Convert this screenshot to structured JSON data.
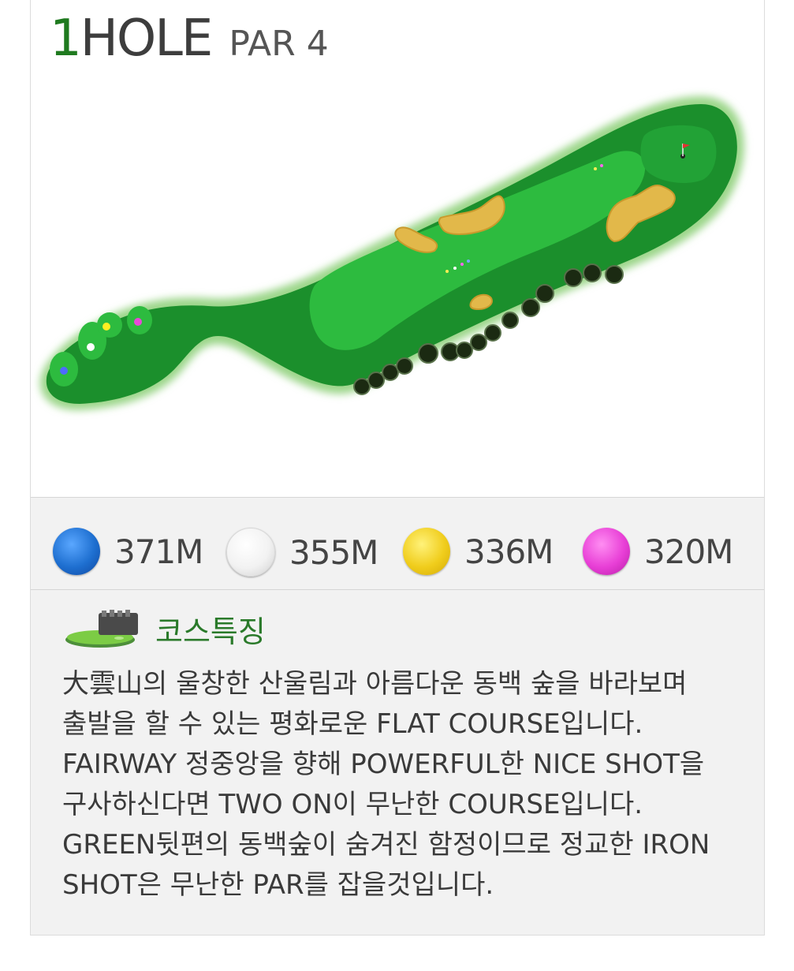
{
  "hole": {
    "number": "1",
    "label": "HOLE",
    "par": "PAR 4"
  },
  "tees": [
    {
      "color_name": "blue",
      "color": "#1e6fd0",
      "distance": "371M"
    },
    {
      "color_name": "white",
      "color": "#f2f2f2",
      "distance": "355M"
    },
    {
      "color_name": "yellow",
      "color": "#f0cd1c",
      "distance": "336M"
    },
    {
      "color_name": "pink",
      "color": "#e83fd6",
      "distance": "320M"
    }
  ],
  "description": {
    "title": "코스특징",
    "icon": "green-course-icon",
    "text": "大雲山의 울창한 산울림과 아름다운 동백 숲을 바라보며\n출발을 할 수 있는 평화로운 FLAT COURSE입니다.\nFAIRWAY 정중앙을 향해 POWERFUL한 NICE SHOT을\n구사하신다면 TWO ON이 무난한 COURSE입니다.\nGREEN뒷편의 동백숲이 숨겨진 함정이므로 정교한 IRON\nSHOT은 무난한 PAR를 잡을것입니다."
  },
  "colors": {
    "accent_green": "#1f7a1f",
    "rough": "#1b8f2c",
    "fairway": "#2dbb3f",
    "bunker": "#e2b84a"
  }
}
